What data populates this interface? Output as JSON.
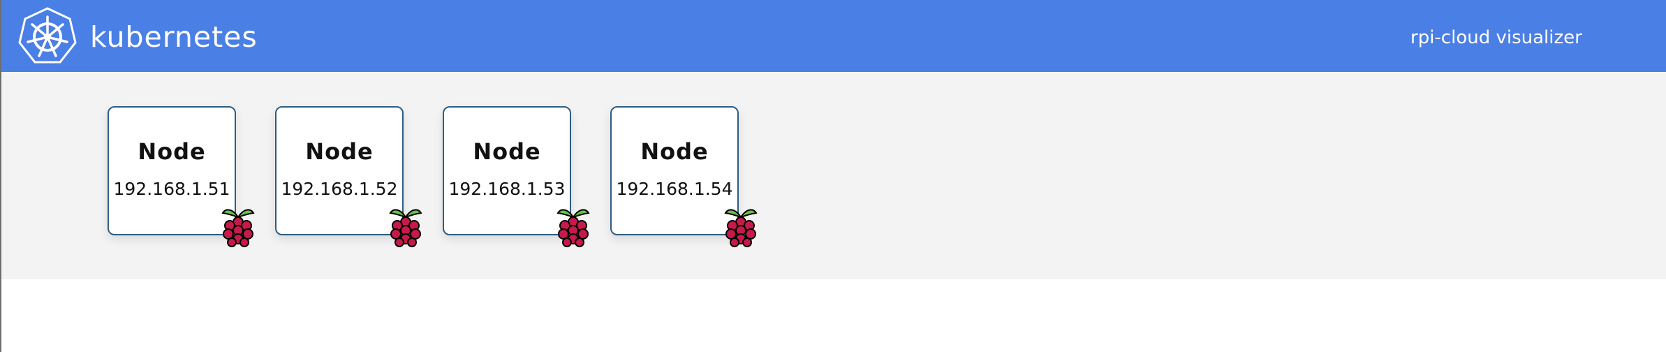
{
  "header": {
    "brand": "kubernetes",
    "title": "rpi-cloud visualizer",
    "logo_icon": "kubernetes-helm-icon",
    "background": "#4a7fe5"
  },
  "stage": {
    "background": "#f3f3f3"
  },
  "nodes": [
    {
      "title": "Node",
      "ip": "192.168.1.51",
      "badge_icon": "raspberry-pi-icon"
    },
    {
      "title": "Node",
      "ip": "192.168.1.52",
      "badge_icon": "raspberry-pi-icon"
    },
    {
      "title": "Node",
      "ip": "192.168.1.53",
      "badge_icon": "raspberry-pi-icon"
    },
    {
      "title": "Node",
      "ip": "192.168.1.54",
      "badge_icon": "raspberry-pi-icon"
    }
  ],
  "colors": {
    "node_border": "#2f5c82",
    "raspberry_berry": "#c51a4a",
    "raspberry_leaf": "#6cc04a"
  }
}
